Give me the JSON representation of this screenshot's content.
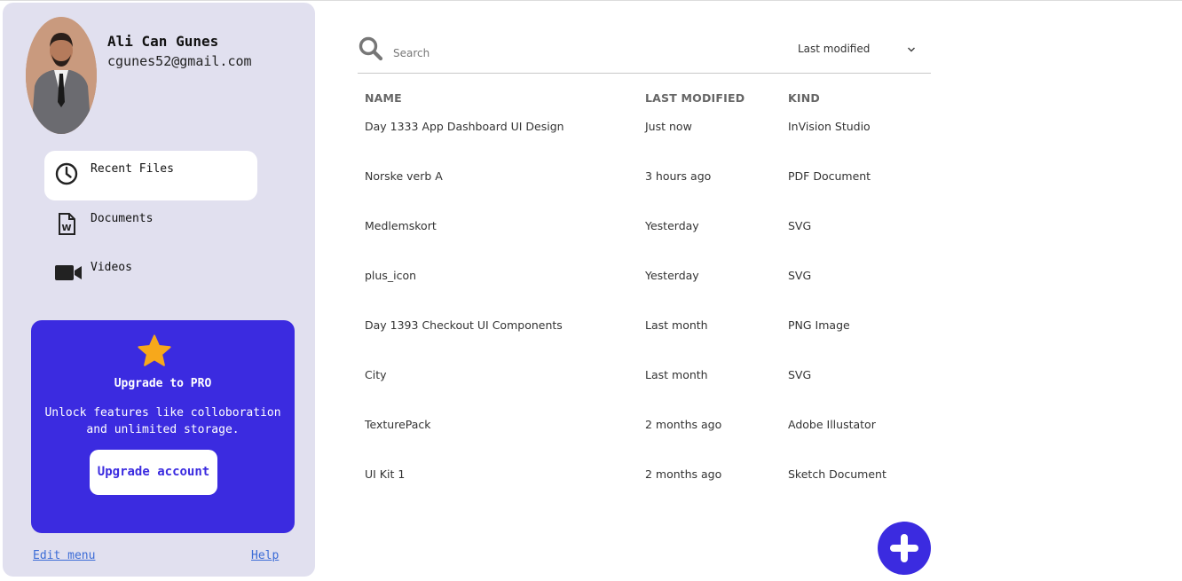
{
  "user": {
    "name": "Ali Can Gunes",
    "email": "cgunes52@gmail.com"
  },
  "nav": {
    "items": [
      {
        "label": "Recent Files",
        "icon": "clock-icon",
        "active": true
      },
      {
        "label": "Documents",
        "icon": "word-document-icon",
        "active": false
      },
      {
        "label": "Videos",
        "icon": "video-camera-icon",
        "active": false
      }
    ]
  },
  "promo": {
    "icon": "star-icon",
    "title": "Upgrade to PRO",
    "description": "Unlock features like colloboration and unlimited storage.",
    "button_label": "Upgrade account"
  },
  "footer": {
    "edit_menu": "Edit menu",
    "help": "Help"
  },
  "search": {
    "placeholder": "Search",
    "value": ""
  },
  "sort": {
    "selected": "Last modified"
  },
  "table": {
    "columns": [
      "NAME",
      "LAST MODIFIED",
      "KIND"
    ],
    "rows": [
      {
        "name": "Day 1333 App Dashboard UI Design",
        "modified": "Just now",
        "kind": "InVision Studio"
      },
      {
        "name": "Norske verb A",
        "modified": "3 hours ago",
        "kind": "PDF Document"
      },
      {
        "name": "Medlemskort",
        "modified": "Yesterday",
        "kind": "SVG"
      },
      {
        "name": "plus_icon",
        "modified": "Yesterday",
        "kind": "SVG"
      },
      {
        "name": "Day 1393 Checkout UI Components",
        "modified": "Last month",
        "kind": "PNG Image"
      },
      {
        "name": "City",
        "modified": "Last month",
        "kind": "SVG"
      },
      {
        "name": "TexturePack",
        "modified": "2 months ago",
        "kind": "Adobe Illustator"
      },
      {
        "name": "UI Kit 1",
        "modified": "2 months ago",
        "kind": "Sketch Document"
      }
    ]
  },
  "colors": {
    "sidebar_bg": "#e1e0ef",
    "accent": "#3b2be0",
    "star": "#f7a81b"
  }
}
